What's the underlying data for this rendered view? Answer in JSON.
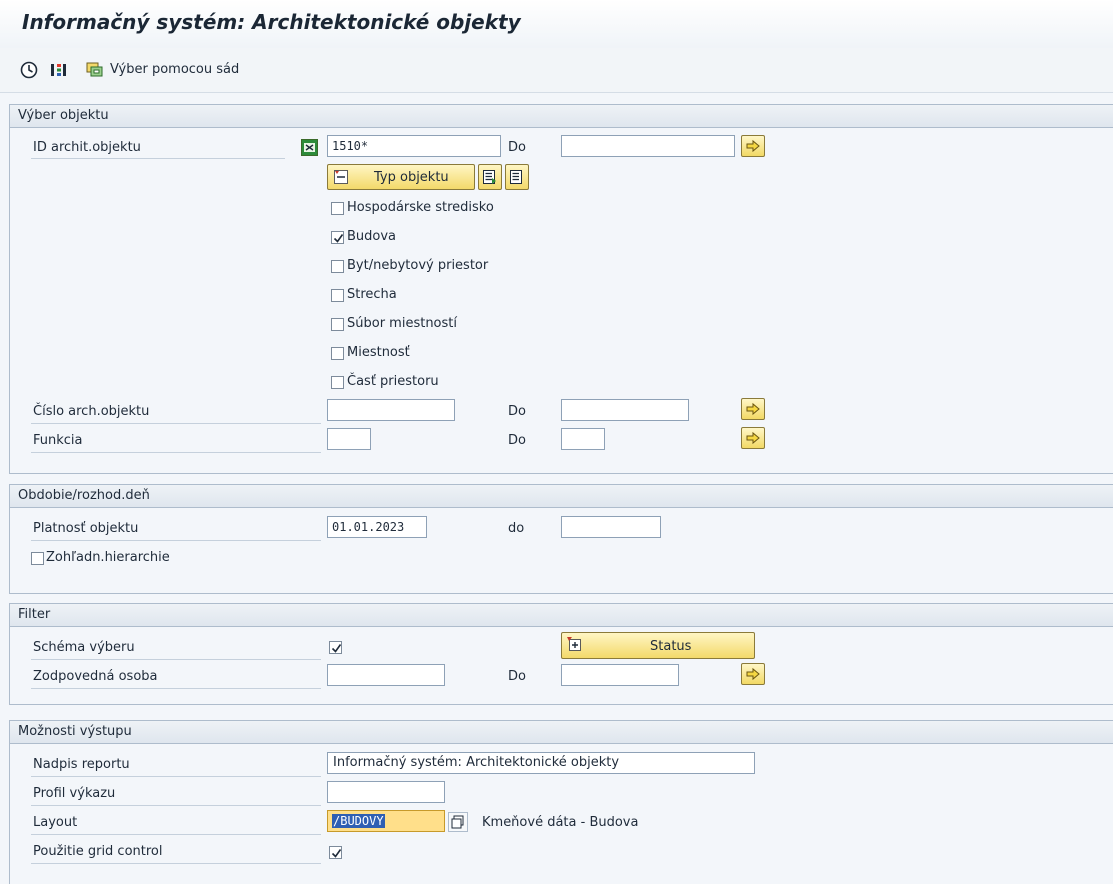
{
  "title": "Informačný systém: Architektonické objekty",
  "toolbar": {
    "execute_icon": "execute-clock-icon",
    "dynamic_selection_icon": "dynamic-selection-icon",
    "selection_sets_icon": "selection-sets-icon",
    "selection_sets_label": "Výber pomocou sád"
  },
  "object_selection": {
    "header": "Výber objektu",
    "id_label": "ID archit.objektu",
    "id_value": "1510*",
    "id_to_label": "Do",
    "id_to_value": "",
    "type_button": "Typ objektu",
    "types": [
      {
        "label": "Hospodárske stredisko",
        "checked": false
      },
      {
        "label": "Budova",
        "checked": true
      },
      {
        "label": "Byt/nebytový priestor",
        "checked": false
      },
      {
        "label": "Strecha",
        "checked": false
      },
      {
        "label": "Súbor miestností",
        "checked": false
      },
      {
        "label": "Miestnosť",
        "checked": false
      },
      {
        "label": "Časť priestoru",
        "checked": false
      }
    ],
    "number_label": "Číslo arch.objektu",
    "number_value": "",
    "number_to_label": "Do",
    "function_label": "Funkcia",
    "function_value": "",
    "function_to_label": "Do"
  },
  "period": {
    "header": "Obdobie/rozhod.deň",
    "validity_label": "Platnosť objektu",
    "validity_from": "01.01.2023",
    "validity_to_label": "do",
    "validity_to": "",
    "hierarchy_label": "Zohľadn.hierarchie",
    "hierarchy_checked": false
  },
  "filter": {
    "header": "Filter",
    "scheme_label": "Schéma výberu",
    "scheme_checked": true,
    "status_button": "Status",
    "responsible_label": "Zodpovedná osoba",
    "responsible_to_label": "Do"
  },
  "output": {
    "header": "Možnosti výstupu",
    "report_title_label": "Nadpis reportu",
    "report_title_value": "Informačný systém: Architektonické objekty",
    "profile_label": "Profil výkazu",
    "profile_value": "",
    "layout_label": "Layout",
    "layout_value": "/BUDOVY",
    "layout_description": "Kmeňové dáta - Budova",
    "grid_label": "Použitie grid control",
    "grid_checked": true
  },
  "colors": {
    "accent_yellow": "#f3d96a",
    "background": "#f3f6fa",
    "header": "#dfe6ee",
    "input_focus": "#ffdf8a"
  }
}
